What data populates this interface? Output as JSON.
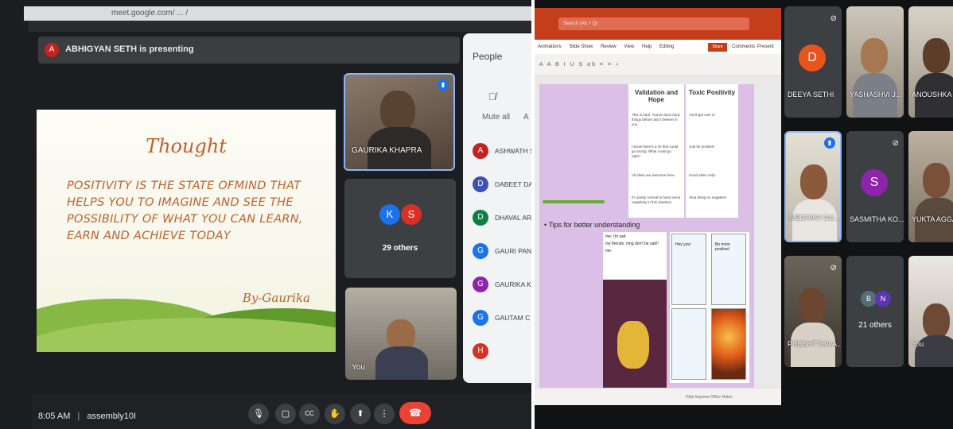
{
  "left": {
    "url": "meet.google.com/ ... /",
    "presenting": {
      "avatar": "A",
      "text": "ABHIGYAN SETH is presenting"
    },
    "slide": {
      "title": "Thought",
      "body": "POSITIVITY IS THE STATE OFMIND THAT HELPS YOU TO IMAGINE AND SEE THE POSSIBILITY OF WHAT YOU CAN LEARN, EARN  AND ACHIEVE TODAY",
      "byline": "By-Gaurika"
    },
    "tiles": {
      "speaker": "GAURIKA KHAPRA",
      "group": {
        "a": "K",
        "b": "S",
        "others": "29 others"
      },
      "self": "You"
    },
    "people_panel": {
      "title": "People",
      "mute_all": "Mute all",
      "mute_all_trail": "A",
      "list": [
        {
          "initial": "A",
          "name": "ASHWATH S",
          "color": "#c5221f"
        },
        {
          "initial": "D",
          "name": "DABEET DAS",
          "color": "#3f51b5"
        },
        {
          "initial": "D",
          "name": "DHAVAL AR",
          "color": "#0b8043"
        },
        {
          "initial": "G",
          "name": "GAURI PAN",
          "color": "#1a73e8"
        },
        {
          "initial": "G",
          "name": "GAURIKA K",
          "color": "#8e24aa"
        },
        {
          "initial": "G",
          "name": "GAUTAM C",
          "color": "#1a73e8"
        },
        {
          "initial": "H",
          "name": "",
          "color": "#d93025"
        }
      ]
    },
    "controls": {
      "time": "8:05 AM",
      "meeting": "assembly10I",
      "separator": "|",
      "buttons": [
        "🎙",
        "▢",
        "CC",
        "✋",
        "⬆",
        "⋮"
      ],
      "end": "☎"
    }
  },
  "right": {
    "ppt": {
      "search": "Search (Alt + Q)",
      "menu": [
        "Animations",
        "Slide Show",
        "Review",
        "View",
        "Help",
        "Editing"
      ],
      "share": "Share",
      "comments": "Comments",
      "present": "Present",
      "ribbon": "A A B I U S ab ≡ ≡ ⌕",
      "status": "Help Improve Office   Notes",
      "slide": {
        "col1": {
          "header": "Validation and Hope",
          "items": [
            "This is hard. You've done hard things before and I believe in you.",
            "I know there's a lot that could go wrong. What could go right?",
            "All vibes are welcome here.",
            "It's pretty normal to have some negativity in this situation."
          ]
        },
        "col2": {
          "header": "Toxic Positivity",
          "items": [
            "You'll get over it!",
            "Just be positive!",
            "Good vibes only!",
            "Stop being so negative!"
          ]
        },
        "tips": "• Tips for better understanding",
        "meme1": [
          "me: i'm sad",
          "my friends: omg don't be sad!!",
          "me:"
        ],
        "meme2": {
          "p1": "Hey you!",
          "p2": "Be more positive!"
        }
      }
    },
    "gallery": [
      {
        "name": "DEEYA SETHI",
        "avatar": "D",
        "color": "#e8541c"
      },
      {
        "name": "YASHASHVI J...",
        "photo": true
      },
      {
        "name": "ANOUSHKA S...",
        "photo": true
      },
      {
        "name": "MEDHAVI GU...",
        "photo": true,
        "speaking": true
      },
      {
        "name": "SASMITHA KO...",
        "avatar": "S",
        "color": "#8e24aa"
      },
      {
        "name": "YUKTA AGGA...",
        "photo": true
      },
      {
        "name": "PRESHTTHA A...",
        "photo": true
      },
      {
        "others": "21 others",
        "a": "B",
        "b": "N"
      },
      {
        "name": "You",
        "photo": true
      }
    ]
  }
}
